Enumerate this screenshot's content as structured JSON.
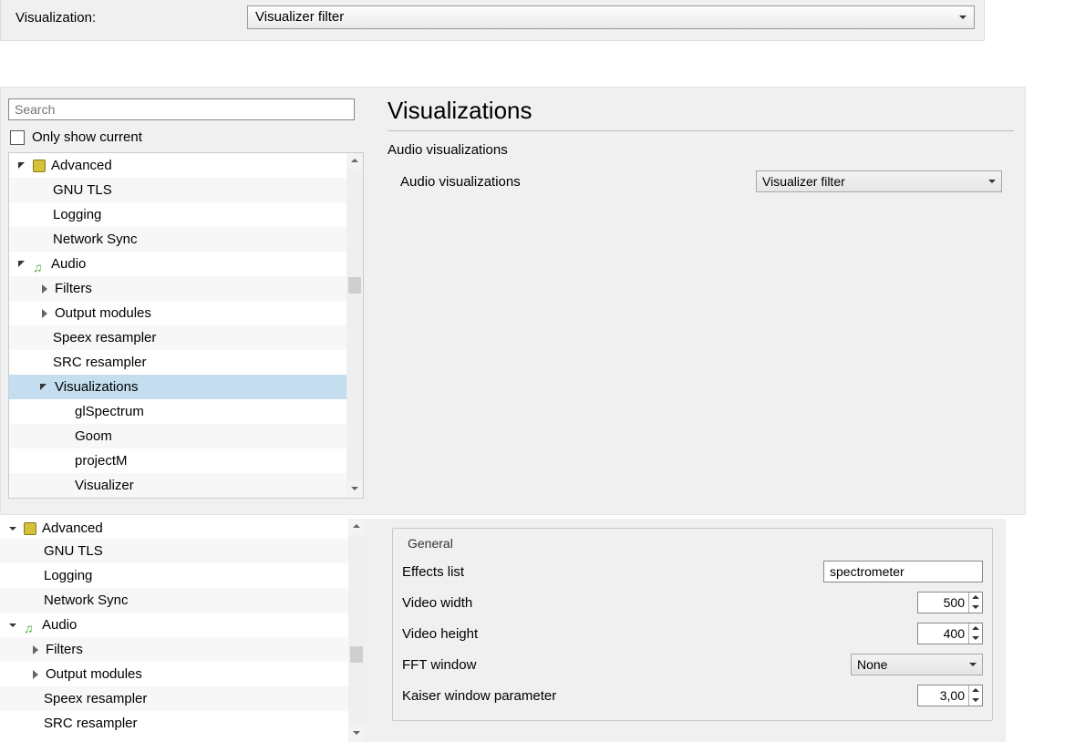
{
  "top": {
    "label": "Visualization:",
    "value": "Visualizer filter"
  },
  "search": {
    "placeholder": "Search"
  },
  "only_show_current": "Only show current",
  "tree_a": {
    "advanced": "Advanced",
    "gnu_tls": "GNU TLS",
    "logging": "Logging",
    "network_sync": "Network Sync",
    "audio": "Audio",
    "filters": "Filters",
    "output_modules": "Output modules",
    "speex": "Speex resampler",
    "src": "SRC resampler",
    "visualizations": "Visualizations",
    "glspectrum": "glSpectrum",
    "goom": "Goom",
    "projectm": "projectM",
    "visualizer": "Visualizer"
  },
  "tree_b": {
    "advanced": "Advanced",
    "gnu_tls": "GNU TLS",
    "logging": "Logging",
    "network_sync": "Network Sync",
    "audio": "Audio",
    "filters": "Filters",
    "output_modules": "Output modules",
    "speex": "Speex resampler",
    "src": "SRC resampler"
  },
  "page": {
    "title": "Visualizations",
    "section": "Audio visualizations",
    "row_label": "Audio visualizations",
    "row_value": "Visualizer filter"
  },
  "general": {
    "legend": "General",
    "effects_list_label": "Effects list",
    "effects_list_value": "spectrometer",
    "video_width_label": "Video width",
    "video_width_value": "500",
    "video_height_label": "Video height",
    "video_height_value": "400",
    "fft_window_label": "FFT window",
    "fft_window_value": "None",
    "kaiser_label": "Kaiser window parameter",
    "kaiser_value": "3,00"
  }
}
